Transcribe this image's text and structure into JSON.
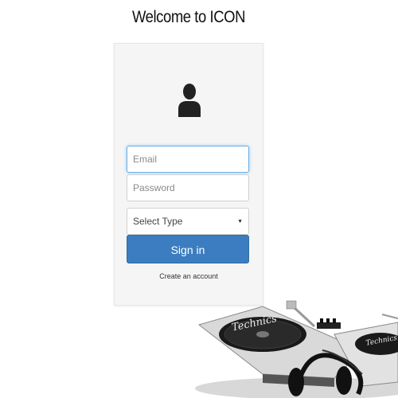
{
  "header": {
    "title": "Welcome to ICON"
  },
  "login": {
    "email_placeholder": "Email",
    "password_placeholder": "Password",
    "type_select": {
      "selected": "Select Type"
    },
    "signin_label": "Sign in",
    "create_account_label": "Create an account"
  },
  "decor": {
    "brand_text": "Technics"
  },
  "colors": {
    "primary": "#3b7dc0",
    "card_bg": "#f5f5f5",
    "focus_border": "#66afe9"
  }
}
